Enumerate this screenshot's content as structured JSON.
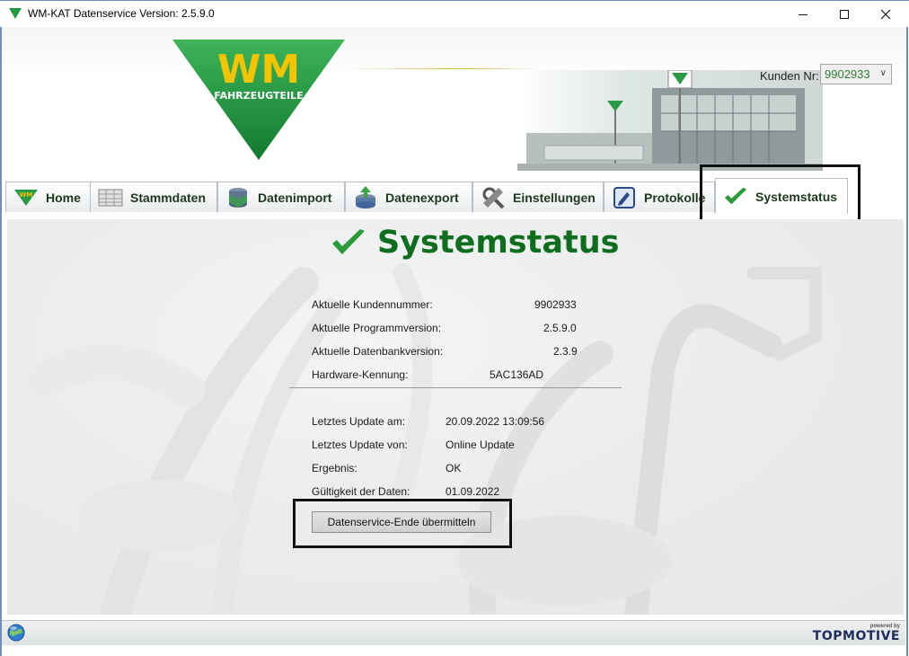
{
  "window": {
    "title": "WM-KAT Datenservice  Version: 2.5.9.0",
    "minimize": "minimize-icon",
    "maximize": "maximize-icon",
    "close": "close-icon"
  },
  "header": {
    "logo_text": "WM",
    "logo_subtext": "FAHRZEUGTEILE",
    "kunden_label": "Kunden Nr:",
    "kunden_value": "9902933"
  },
  "tabs": [
    {
      "label": "Home",
      "icon": "wm-logo-icon"
    },
    {
      "label": "Stammdaten",
      "icon": "table-icon"
    },
    {
      "label": "Datenimport",
      "icon": "database-import-icon"
    },
    {
      "label": "Datenexport",
      "icon": "database-export-icon"
    },
    {
      "label": "Einstellungen",
      "icon": "tools-icon"
    },
    {
      "label": "Protokolle",
      "icon": "log-icon"
    },
    {
      "label": "Systemstatus",
      "icon": "checkmark-icon",
      "active": true
    }
  ],
  "status": {
    "headline": "Systemstatus",
    "rows_top": [
      {
        "label": "Aktuelle Kundennummer:",
        "value": "9902933"
      },
      {
        "label": "Aktuelle Programmversion:",
        "value": "2.5.9.0"
      },
      {
        "label": "Aktuelle Datenbankversion:",
        "value": "2.3.9"
      },
      {
        "label": "Hardware-Kennung:",
        "value": "5AC136AD"
      }
    ],
    "rows_bottom": [
      {
        "label": "Letztes Update am:",
        "value": "20.09.2022 13:09:56"
      },
      {
        "label": "Letztes Update von:",
        "value": "Online Update"
      },
      {
        "label": "Ergebnis:",
        "value": "OK"
      },
      {
        "label": "Gültigkeit der Daten:",
        "value": "01.09.2022"
      }
    ],
    "button_label": "Datenservice-Ende übermitteln"
  },
  "footer": {
    "powered_by": "powered by",
    "brand": "TOPMOTIVE"
  },
  "colors": {
    "accent_green": "#0f6d1e",
    "logo_green": "#1f9a3f",
    "logo_yellow": "#f5c400",
    "highlight_border": "#111111"
  }
}
